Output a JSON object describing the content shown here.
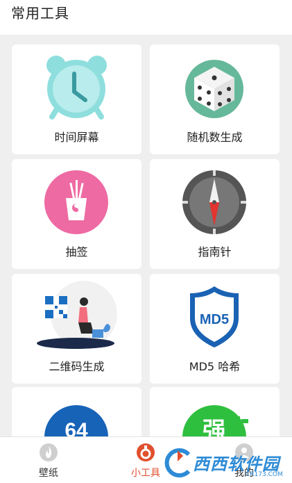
{
  "header": {
    "title": "常用工具"
  },
  "tools": [
    {
      "label": "时间屏幕",
      "icon": "alarm-clock-icon",
      "color": "#8fdede"
    },
    {
      "label": "随机数生成",
      "icon": "dice-icon",
      "color": "#66b89a"
    },
    {
      "label": "抽签",
      "icon": "lot-drawing-icon",
      "color": "#ee6aa2"
    },
    {
      "label": "指南针",
      "icon": "compass-icon",
      "color": "#555555"
    },
    {
      "label": "二维码生成",
      "icon": "qr-code-icon",
      "color": "#1b6fc2"
    },
    {
      "label": "MD5 哈希",
      "icon": "md5-shield-icon",
      "color": "#1a62b3"
    },
    {
      "label": "",
      "icon": "base64-icon",
      "color": "#1763b8"
    },
    {
      "label": "",
      "icon": "strong-password-icon",
      "color": "#2fbf3f"
    }
  ],
  "icon_texts": {
    "md5": "MD5",
    "base64": "64",
    "strong": "强"
  },
  "nav": [
    {
      "label": "壁纸",
      "icon": "flame-icon",
      "active": false
    },
    {
      "label": "小工具",
      "icon": "tools-icon",
      "active": true
    },
    {
      "label": "我的",
      "icon": "user-icon",
      "active": false
    }
  ],
  "watermark": {
    "text": "西西软件园",
    "sub": "CR173.COM"
  },
  "colors": {
    "accent": "#e0502e",
    "background": "#efefef",
    "card": "#ffffff"
  }
}
